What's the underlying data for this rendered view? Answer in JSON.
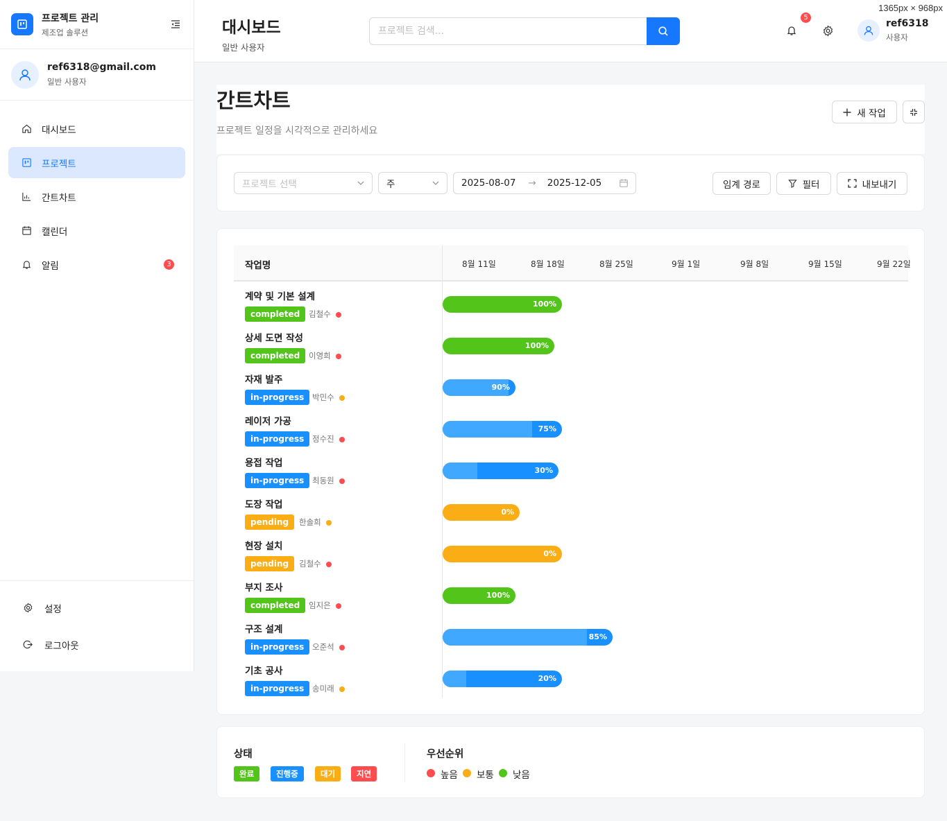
{
  "screen_note": "1365px × 968px",
  "brand": {
    "title": "프로젝트 관리",
    "subtitle": "제조업 솔루션"
  },
  "user": {
    "email": "ref6318@gmail.com",
    "role": "일반 사용자"
  },
  "nav": {
    "items": [
      {
        "label": "대시보드",
        "icon": "home-icon"
      },
      {
        "label": "프로젝트",
        "icon": "project-icon",
        "active": true
      },
      {
        "label": "간트차트",
        "icon": "chart-icon"
      },
      {
        "label": "캘린더",
        "icon": "calendar-icon"
      },
      {
        "label": "알림",
        "icon": "bell-icon",
        "badge": "3"
      }
    ],
    "bottom": [
      {
        "label": "설정",
        "icon": "gear-icon"
      },
      {
        "label": "로그아웃",
        "icon": "logout-icon"
      }
    ]
  },
  "header": {
    "title": "대시보드",
    "subtitle": "일반 사용자",
    "search_placeholder": "프로젝트 검색...",
    "notification_count": "5",
    "user_name": "ref6318",
    "user_role": "사용자"
  },
  "page": {
    "title": "간트차트",
    "description": "프로젝트 일정을 시각적으로 관리하세요",
    "new_task_label": "새 작업"
  },
  "filters": {
    "project_placeholder": "프로젝트 선택",
    "view_mode": "주",
    "date_start": "2025-08-07",
    "date_end": "2025-12-05",
    "critical_path_label": "임계 경로",
    "filter_label": "필터",
    "export_label": "내보내기"
  },
  "gantt": {
    "task_column_label": "작업명",
    "weeks": [
      "8월 11일",
      "8월 18일",
      "8월 25일",
      "9월 1일",
      "9월 8일",
      "9월 15일",
      "9월 22일"
    ],
    "tasks": [
      {
        "name": "계약 및 기본 설계",
        "status": "completed",
        "assignee": "김철수",
        "priority": "high",
        "progress_label": "100%",
        "progress": 100
      },
      {
        "name": "상세 도면 작성",
        "status": "completed",
        "assignee": "이영희",
        "priority": "high",
        "progress_label": "100%",
        "progress": 100
      },
      {
        "name": "자재 발주",
        "status": "in-progress",
        "assignee": "박민수",
        "priority": "medium",
        "progress_label": "90%",
        "progress": 90
      },
      {
        "name": "레이저 가공",
        "status": "in-progress",
        "assignee": "정수진",
        "priority": "high",
        "progress_label": "75%",
        "progress": 75
      },
      {
        "name": "용접 작업",
        "status": "in-progress",
        "assignee": "최동원",
        "priority": "high",
        "progress_label": "30%",
        "progress": 30
      },
      {
        "name": "도장 작업",
        "status": "pending",
        "assignee": "한솔희",
        "priority": "medium",
        "progress_label": "0%",
        "progress": 0
      },
      {
        "name": "현장 설치",
        "status": "pending",
        "assignee": "김철수",
        "priority": "high",
        "progress_label": "0%",
        "progress": 0
      },
      {
        "name": "부지 조사",
        "status": "completed",
        "assignee": "임지은",
        "priority": "high",
        "progress_label": "100%",
        "progress": 100
      },
      {
        "name": "구조 설계",
        "status": "in-progress",
        "assignee": "오준석",
        "priority": "high",
        "progress_label": "85%",
        "progress": 85
      },
      {
        "name": "기초 공사",
        "status": "in-progress",
        "assignee": "송미래",
        "priority": "medium",
        "progress_label": "20%",
        "progress": 20
      }
    ]
  },
  "legend": {
    "status_title": "상태",
    "statuses": [
      {
        "label": "완료",
        "color": "#52c41a"
      },
      {
        "label": "진행중",
        "color": "#1890ff"
      },
      {
        "label": "대기",
        "color": "#faad14"
      },
      {
        "label": "지연",
        "color": "#ff4d4f"
      }
    ],
    "priority_title": "우선순위",
    "priorities": [
      {
        "label": "높음",
        "color": "#ff4d4f"
      },
      {
        "label": "보통",
        "color": "#faad14"
      },
      {
        "label": "낮음",
        "color": "#52c41a"
      }
    ]
  },
  "colors": {
    "accent": "#1677ff",
    "completed": "#52c41a",
    "in_progress": "#1890ff",
    "in_progress_fill": "#40a9ff",
    "pending": "#faad14",
    "priority_high": "#ff4d4f",
    "priority_medium": "#faad14"
  }
}
